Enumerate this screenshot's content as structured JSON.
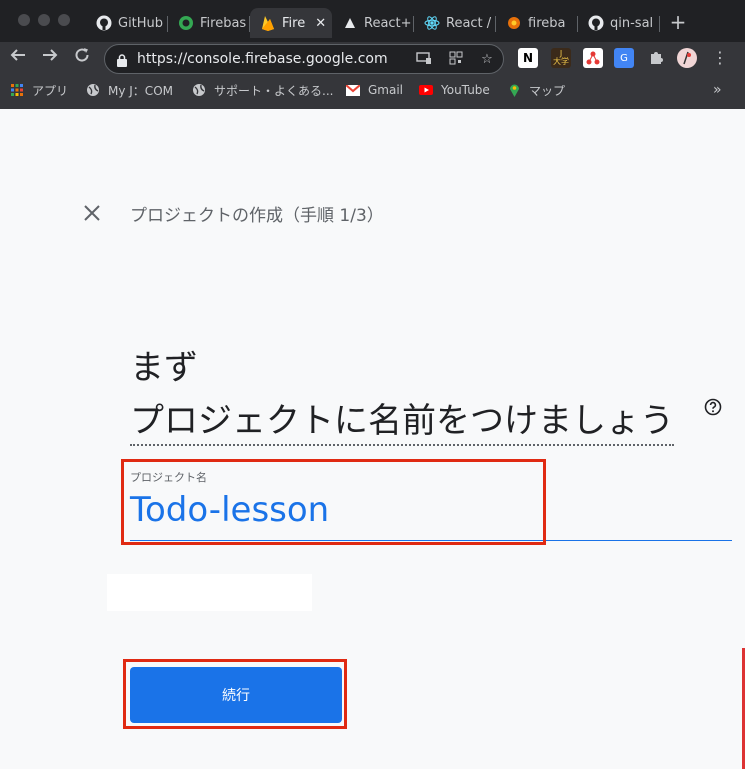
{
  "browser": {
    "tabs": [
      {
        "label": "GitHub",
        "icon": "github-icon"
      },
      {
        "label": "Firebas",
        "icon": "firebase-green-icon"
      },
      {
        "label": "Fire",
        "icon": "firebase-flame-icon"
      },
      {
        "label": "React+",
        "icon": "vercel-icon"
      },
      {
        "label": "React /",
        "icon": "react-icon"
      },
      {
        "label": "fireba",
        "icon": "firebase-orange-icon"
      },
      {
        "label": "qin-sal",
        "icon": "github-icon"
      }
    ],
    "active_tab_close": "✕",
    "new_tab": "+",
    "url": "https://console.firebase.google.com",
    "bookmarks": [
      {
        "label": "アプリ",
        "icon": "apps-grid-icon"
      },
      {
        "label": "My J：COM",
        "icon": "globe-icon"
      },
      {
        "label": "サポート・よくある...",
        "icon": "globe-icon"
      },
      {
        "label": "Gmail",
        "icon": "gmail-icon"
      },
      {
        "label": "YouTube",
        "icon": "youtube-icon"
      },
      {
        "label": "マップ",
        "icon": "maps-icon"
      }
    ],
    "bookmarks_more": "»",
    "ext_j": "J\n大学",
    "menu": "⋮"
  },
  "page": {
    "header_title": "プロジェクトの作成（手順 1/3）",
    "heading_line1": "まず",
    "heading_line2": "プロジェクトに名前をつけましょう",
    "field_label": "プロジェクト名",
    "field_value": "Todo-lesson",
    "continue_label": "続行"
  },
  "colors": {
    "accent": "#1a73e8",
    "highlight": "#e02a12"
  }
}
